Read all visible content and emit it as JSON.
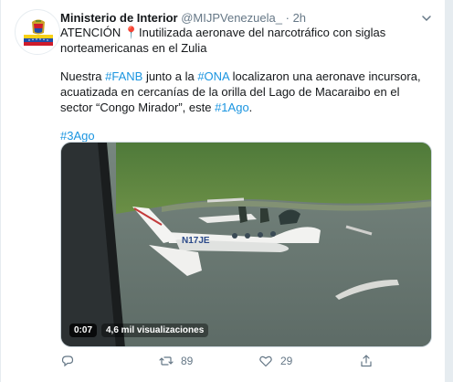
{
  "tweet": {
    "author_name": "Ministerio de Interior",
    "author_handle": "@MIJPVenezuela_",
    "separator": "·",
    "time": "2h",
    "line1": "ATENCIÓN 📍Inutilizada aeronave del narcotráfico con siglas norteamericanas en el Zulia",
    "p2_a": "Nuestra ",
    "p2_tag1": "#FANB",
    "p2_b": " junto a la ",
    "p2_tag2": "#ONA",
    "p2_c": " localizaron una aeronave incursora, acuatizada en cercanías de la orilla del Lago de Macaraibo en el sector “Congo Mirador”, este ",
    "p2_tag3": "#1Ago",
    "p2_d": ".",
    "hashtag_footer": "#3Ago"
  },
  "media": {
    "duration": "0:07",
    "views": "4,6 mil visualizaciones",
    "plane_registration": "N17JE"
  },
  "actions": {
    "reply_count": "",
    "retweet_count": "89",
    "like_count": "29"
  },
  "colors": {
    "link": "#1b95e0",
    "muted": "#657786",
    "text": "#14171a"
  },
  "icons": {
    "reply": "reply-icon",
    "retweet": "retweet-icon",
    "like": "heart-icon",
    "share": "share-icon",
    "menu": "chevron-down-icon"
  }
}
